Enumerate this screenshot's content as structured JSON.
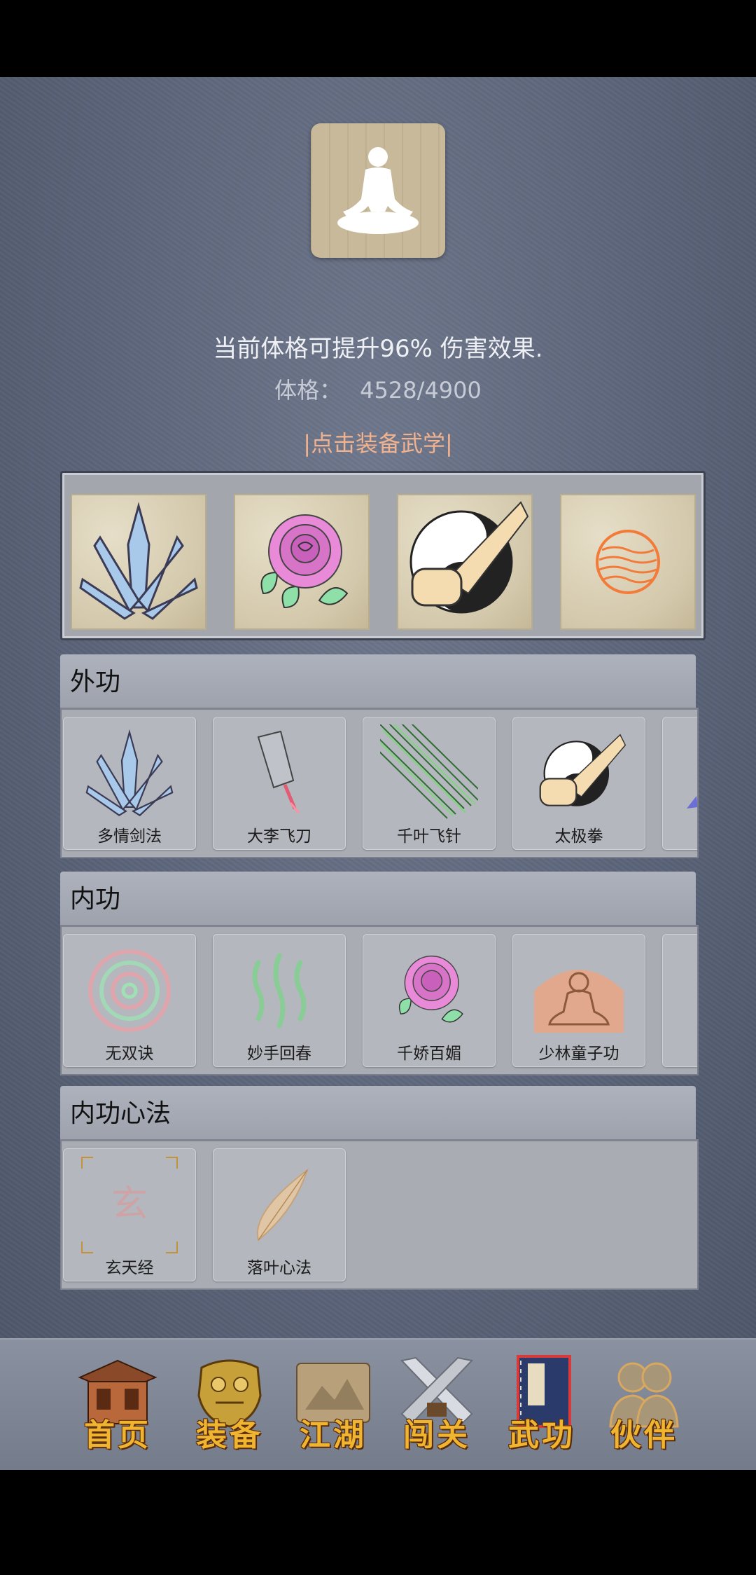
{
  "player": {
    "buff_text": "当前体格可提升96% 伤害效果.",
    "stat_label": "体格：",
    "stat_value": "4528/4900",
    "equip_link": "|点击装备武学|"
  },
  "equipped": [
    {
      "icon": "crystal-blades-icon"
    },
    {
      "icon": "peony-flower-icon"
    },
    {
      "icon": "taiji-fist-icon"
    },
    {
      "icon": "orange-energy-orb-icon"
    }
  ],
  "sections": {
    "external": {
      "title": "外功",
      "skills": [
        {
          "name": "多情剑法",
          "icon": "crystal-blades-icon"
        },
        {
          "name": "大李飞刀",
          "icon": "flying-cleaver-icon"
        },
        {
          "name": "千叶飞针",
          "icon": "flying-needles-icon"
        },
        {
          "name": "太极拳",
          "icon": "taiji-fist-icon"
        },
        {
          "name": "",
          "icon": "partial-skill-icon"
        }
      ]
    },
    "internal": {
      "title": "内功",
      "skills": [
        {
          "name": "无双诀",
          "icon": "spiral-energy-icon"
        },
        {
          "name": "妙手回春",
          "icon": "healing-waves-icon"
        },
        {
          "name": "千娇百媚",
          "icon": "peony-flower-icon"
        },
        {
          "name": "少林童子功",
          "icon": "meditating-monk-icon"
        },
        {
          "name": "",
          "icon": "partial-skill-icon"
        }
      ]
    },
    "mental": {
      "title": "内功心法",
      "skills": [
        {
          "name": "玄天经",
          "icon": "xuan-rune-icon",
          "rune": "玄"
        },
        {
          "name": "落叶心法",
          "icon": "falling-leaf-icon"
        }
      ]
    }
  },
  "nav": [
    {
      "label": "首页",
      "icon": "pavilion-icon"
    },
    {
      "label": "装备",
      "icon": "golden-armor-icon"
    },
    {
      "label": "江湖",
      "icon": "scroll-map-icon"
    },
    {
      "label": "闯关",
      "icon": "crossed-swords-icon"
    },
    {
      "label": "武功",
      "icon": "martial-manual-icon",
      "active": true
    },
    {
      "label": "伙伴",
      "icon": "companions-icon"
    }
  ],
  "colors": {
    "background": "#5a6378",
    "link": "#f0b28f",
    "nav_label": "#f0b530"
  }
}
